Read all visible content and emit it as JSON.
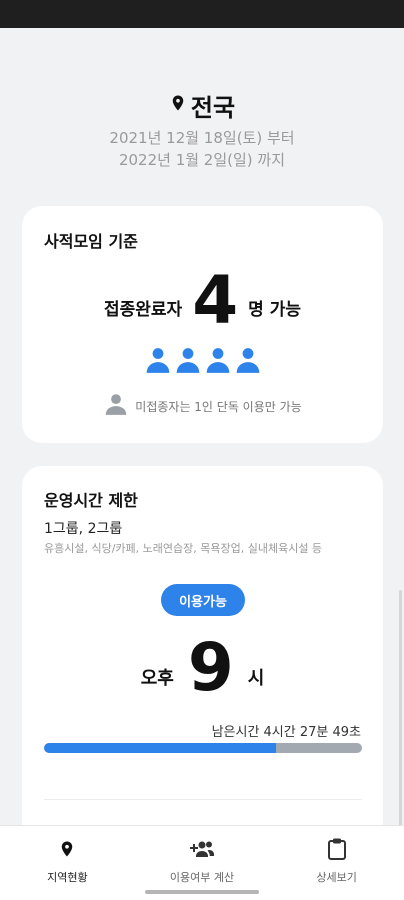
{
  "region": {
    "name": "전국",
    "date_from": "2021년 12월 18일(토) 부터",
    "date_to": "2022년 1월 2일(일) 까지"
  },
  "gathering": {
    "title": "사적모임 기준",
    "vaccinated_label": "접종완료자",
    "count": "4",
    "count_suffix": "명 가능",
    "people_icons": 4,
    "unvaccinated_note": "미접종자는 1인 단독 이용만 가능"
  },
  "hours": {
    "title": "운영시간 제한",
    "groups": "1그룹, 2그룹",
    "venues": "유흥시설, 식당/카페, 노래연습장, 목욕장업, 실내체육시설 등",
    "status": "이용가능",
    "time_prefix": "오후",
    "time_hour": "9",
    "time_suffix": "시",
    "remaining": "남은시간 4시간 27분 49초",
    "progress_fraction": 0.73
  },
  "colors": {
    "accent": "#2e83ea",
    "track": "#a3a9b1",
    "background": "#f1f2f4"
  },
  "nav": {
    "items": [
      {
        "label": "지역현황",
        "icon": "location-pin-icon",
        "active": true
      },
      {
        "label": "이용여부 계산",
        "icon": "add-people-icon",
        "active": false
      },
      {
        "label": "상세보기",
        "icon": "clipboard-icon",
        "active": false
      }
    ]
  }
}
